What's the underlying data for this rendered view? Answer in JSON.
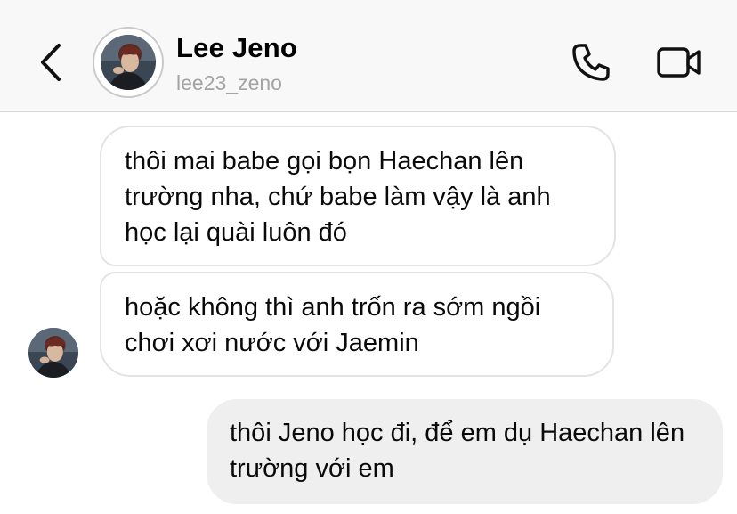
{
  "header": {
    "contact_name": "Lee Jeno",
    "contact_handle": "lee23_zeno",
    "icons": {
      "back": "chevron-left-icon",
      "call": "phone-icon",
      "video": "video-camera-icon"
    }
  },
  "messages": [
    {
      "direction": "received",
      "text": "thôi mai babe gọi bọn Haechan lên trường nha, chứ babe làm vậy là anh học lại quài luôn đó"
    },
    {
      "direction": "received",
      "text": "hoặc không thì anh trốn ra sớm ngồi chơi xơi nước với Jaemin"
    },
    {
      "direction": "sent",
      "text": "thôi Jeno học đi, để em dụ Haechan lên trường với em"
    }
  ],
  "colors": {
    "header_bg": "#f8f8f8",
    "received_bubble_border": "#e3e3e3",
    "sent_bubble_bg": "#efefef",
    "handle_text": "#a3a3a3"
  }
}
